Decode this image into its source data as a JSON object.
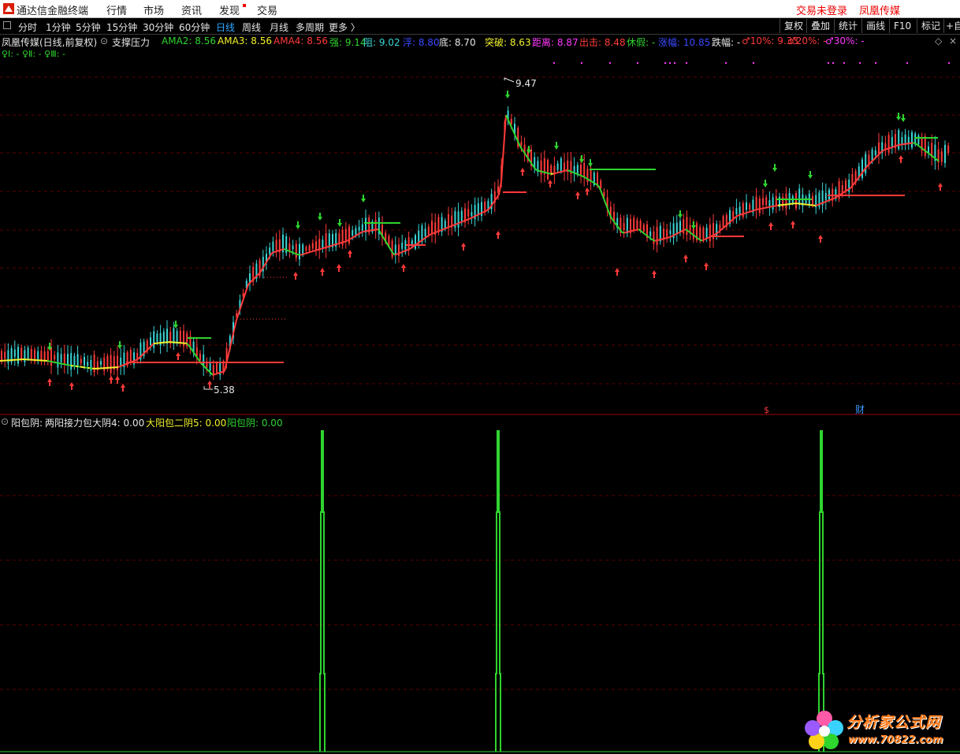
{
  "app": {
    "title": "通达信金融终端",
    "menus": [
      "行情",
      "市场",
      "资讯",
      "发现",
      "交易"
    ],
    "login_status": "交易未登录",
    "stock_name": "凤凰传媒"
  },
  "toolbar": {
    "periods": [
      "分时",
      "1分钟",
      "5分钟",
      "15分钟",
      "30分钟",
      "60分钟",
      "日线",
      "周线",
      "月线",
      "多周期",
      "更多 〉"
    ],
    "active_period": "日线",
    "right_buttons": [
      "复权",
      "叠加",
      "统计",
      "画线",
      "F10",
      "标记",
      "+自"
    ]
  },
  "main_legend": {
    "stock": "凤凰传媒(日线,前复权)",
    "formula": "支撑压力",
    "items": [
      {
        "label": "AMA2: 8.56",
        "color": "#2fd42f"
      },
      {
        "label": "AMA3: 8.56",
        "color": "#f2f22a"
      },
      {
        "label": "AMA4: 8.56",
        "color": "#ff3a3a"
      },
      {
        "label": "强: 9.14",
        "color": "#2fd42f"
      },
      {
        "label": "阻: 9.02",
        "color": "#3ad6d6"
      },
      {
        "label": "浮: 8.80",
        "color": "#3a4aff"
      },
      {
        "label": "底: 8.70",
        "color": "#e6e6e6"
      },
      {
        "label": "突破: 8.63",
        "color": "#f2f22a"
      },
      {
        "label": "距离: 8.87",
        "color": "#ff3aff"
      },
      {
        "label": "出击: 8.48",
        "color": "#ff3a3a"
      },
      {
        "label": "休假: -",
        "color": "#2fd42f"
      },
      {
        "label": "涨幅: 10.85",
        "color": "#3a4aff"
      },
      {
        "label": "跌幅: -",
        "color": "#e6e6e6"
      },
      {
        "label": "♂10%: 9.33",
        "color": "#ff3a3a"
      },
      {
        "label": "♂20%: -",
        "color": "#ff3a3a"
      },
      {
        "label": "♂30%: -",
        "color": "#ff3aff"
      }
    ],
    "sub_line": "♀Ⅰ: -  ♀Ⅱ: -  ♀Ⅲ: -"
  },
  "price_labels": {
    "high": "9.47",
    "low": "5.38"
  },
  "event_marks": {
    "s": "$",
    "cai": "财"
  },
  "indicator_legend": {
    "name": "阳包阴:",
    "items": [
      {
        "label": "两阳接力包大阴4: 0.00",
        "color": "#e6e6e6"
      },
      {
        "label": "大阳包二阴5: 0.00",
        "color": "#f2f22a"
      },
      {
        "label": "阳包阴: 0.00",
        "color": "#2fd42f"
      }
    ]
  },
  "watermark": {
    "text": "分析家公式网",
    "url": "www.70822.com"
  },
  "colors": {
    "up": "#ff3a3a",
    "down": "#3ad6d6",
    "green": "#2fd42f",
    "yellow": "#f2f22a",
    "grid": "#5a0000"
  }
}
